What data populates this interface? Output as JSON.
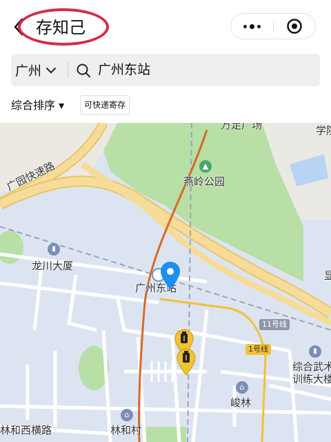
{
  "header": {
    "title": "存知己",
    "more_icon": "more-dots-icon",
    "close_icon": "target-close-icon"
  },
  "search": {
    "city": "广州",
    "query": "广州东站",
    "search_icon": "search-icon",
    "city_chevron_icon": "chevron-down-icon"
  },
  "filters": {
    "sort_label": "综合排序 ▾",
    "tag_label": "可快递寄存"
  },
  "map": {
    "labels": {
      "park": "燕岭公园",
      "guangyuan_expressway": "广园快速路",
      "longchuan": "龙川大厦",
      "station": "广州东站",
      "line11": "11号线",
      "line1": "1号线",
      "junlin": "峻林",
      "linhecun": "林和村",
      "linhexiheng": "林和西横路",
      "xueyuan": "学院",
      "zonghewu": "综合武术",
      "xunliandalou": "训练大楼",
      "top_partial": "万足广场",
      "right_edge": "显"
    },
    "marker_icons": [
      "location-pin-icon",
      "luggage-pin-icon",
      "luggage-pin-icon"
    ],
    "colors": {
      "map_bg": "#dde4f1",
      "park_green": "#b8dfa5",
      "expressway": "#f1d28a",
      "pin_blue": "#1d8ff0",
      "pin_yellow": "#f1c232",
      "rail_orange": "#d46a2a"
    }
  }
}
